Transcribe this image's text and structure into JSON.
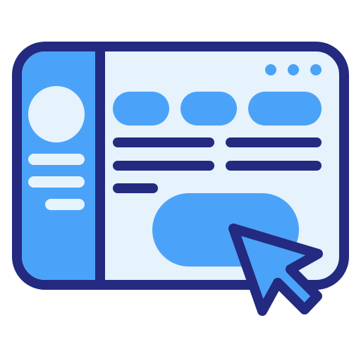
{
  "illustration": {
    "subject": "browser-window-with-cursor-icon",
    "icon_names": [
      "window-icon",
      "avatar-icon",
      "cursor-arrow-icon"
    ],
    "colors": {
      "outline": "#232a7f",
      "window_fill": "#e6f2fc",
      "accent": "#4aa3f8",
      "text_lines": "#232a7f",
      "sidebar_text": "#e6f2fc"
    },
    "window_controls": [
      "dot",
      "dot",
      "dot"
    ],
    "tabs": [
      "pill",
      "pill",
      "pill"
    ],
    "text_line_count": 5,
    "sidebar_line_count": 3
  }
}
